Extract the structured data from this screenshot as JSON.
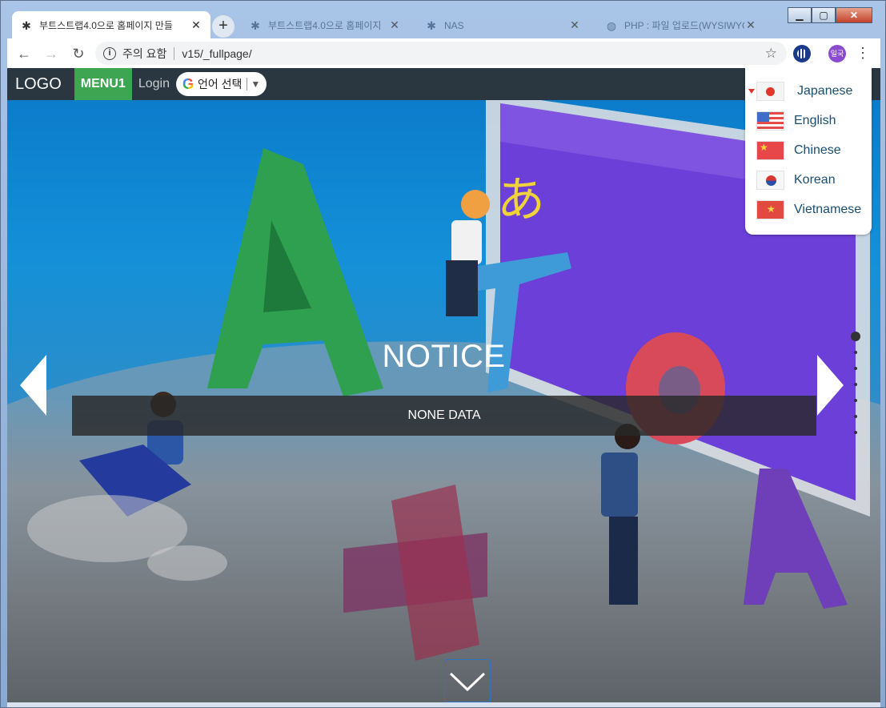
{
  "browser": {
    "tabs": [
      {
        "title": "부트스트랩4.0으로 홈페이지 만들",
        "active": true
      },
      {
        "title": "부트스트랩4.0으로 홈페이지",
        "active": false
      },
      {
        "title": "NAS",
        "active": false
      },
      {
        "title": "PHP : 파일 업로드(WYSIWYG",
        "active": false
      }
    ],
    "new_tab": "+",
    "address": {
      "security": "주의 요함",
      "url": "v15/_fullpage/"
    },
    "profile_label": "일국"
  },
  "site": {
    "logo": "LOGO",
    "menu1": "MENU1",
    "login": "Login",
    "translate_label": "언어 선택",
    "languages": [
      {
        "name": "Japanese",
        "flag": "jp"
      },
      {
        "name": "English",
        "flag": "us"
      },
      {
        "name": "Chinese",
        "flag": "cn"
      },
      {
        "name": "Korean",
        "flag": "kr"
      },
      {
        "name": "Vietnamese",
        "flag": "vn"
      }
    ],
    "section_title": "NOTICE",
    "section_content": "NONE DATA",
    "pager": {
      "count": 7,
      "active": 1
    }
  },
  "colors": {
    "menu_active": "#3ea552",
    "nav_bg": "#2a3640"
  }
}
